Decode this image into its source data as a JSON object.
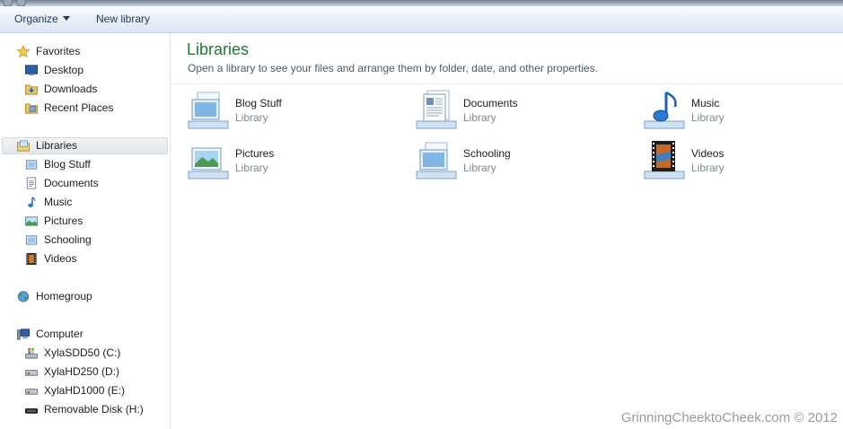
{
  "toolbar": {
    "organize_label": "Organize",
    "new_library_label": "New library"
  },
  "nav": {
    "favorites": {
      "label": "Favorites",
      "items": [
        {
          "label": "Desktop",
          "icon": "desktop-icon"
        },
        {
          "label": "Downloads",
          "icon": "downloads-folder-icon"
        },
        {
          "label": "Recent Places",
          "icon": "recent-places-icon"
        }
      ]
    },
    "libraries": {
      "label": "Libraries",
      "items": [
        {
          "label": "Blog Stuff",
          "icon": "library-icon"
        },
        {
          "label": "Documents",
          "icon": "documents-library-icon"
        },
        {
          "label": "Music",
          "icon": "music-library-icon"
        },
        {
          "label": "Pictures",
          "icon": "pictures-library-icon"
        },
        {
          "label": "Schooling",
          "icon": "library-icon"
        },
        {
          "label": "Videos",
          "icon": "videos-library-icon"
        }
      ]
    },
    "homegroup": {
      "label": "Homegroup"
    },
    "computer": {
      "label": "Computer",
      "items": [
        {
          "label": "XylaSDD50 (C:)",
          "icon": "system-drive-icon"
        },
        {
          "label": "XylaHD250 (D:)",
          "icon": "hard-drive-icon"
        },
        {
          "label": "XylaHD1000 (E:)",
          "icon": "hard-drive-icon"
        },
        {
          "label": "Removable Disk (H:)",
          "icon": "removable-disk-icon"
        }
      ]
    }
  },
  "content": {
    "title": "Libraries",
    "subtitle": "Open a library to see your files and arrange them by folder, date, and other properties.",
    "libraries": [
      {
        "name": "Blog Stuff",
        "type": "Library",
        "icon": "library-icon"
      },
      {
        "name": "Documents",
        "type": "Library",
        "icon": "documents-library-icon"
      },
      {
        "name": "Music",
        "type": "Library",
        "icon": "music-library-icon"
      },
      {
        "name": "Pictures",
        "type": "Library",
        "icon": "pictures-library-icon"
      },
      {
        "name": "Schooling",
        "type": "Library",
        "icon": "library-icon"
      },
      {
        "name": "Videos",
        "type": "Library",
        "icon": "videos-library-icon"
      }
    ]
  },
  "watermark": "GrinningCheektoCheek.com © 2012",
  "colors": {
    "title_green": "#1e7a33",
    "toolbar_text": "#1e395b",
    "secondary_text": "#7f8b95"
  }
}
